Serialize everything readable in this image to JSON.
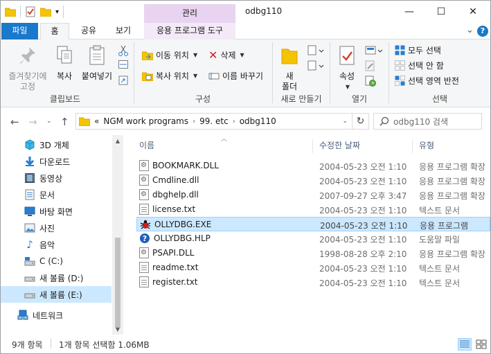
{
  "window": {
    "title": "odbg110",
    "context_tab_header": "관리"
  },
  "ribbon_tabs": {
    "file": "파일",
    "home": "홈",
    "share": "공유",
    "view": "보기",
    "app_tools": "응용 프로그램 도구"
  },
  "ribbon": {
    "clipboard": {
      "label": "클립보드",
      "pin": "즐겨찾기에\n고정",
      "pin_line1": "즐겨찾기에",
      "pin_line2": "고정",
      "copy": "복사",
      "paste": "붙여넣기"
    },
    "organize": {
      "label": "구성",
      "move_to": "이동 위치",
      "copy_to": "복사 위치",
      "delete": "삭제",
      "rename": "이름 바꾸기"
    },
    "new": {
      "label": "새로 만들기",
      "new_folder_line1": "새",
      "new_folder_line2": "폴더"
    },
    "open": {
      "label": "열기",
      "properties": "속성"
    },
    "select": {
      "label": "선택",
      "select_all": "모두 선택",
      "select_none": "선택 안 함",
      "invert": "선택 영역 반전"
    }
  },
  "address": {
    "overflow": "«",
    "crumbs": [
      "NGM work programs",
      "99. etc",
      "odbg110"
    ]
  },
  "search": {
    "placeholder": "odbg110 검색"
  },
  "nav_pane": {
    "items": [
      {
        "label": "3D 개체",
        "icon": "3d-objects-icon"
      },
      {
        "label": "다운로드",
        "icon": "download-icon"
      },
      {
        "label": "동영상",
        "icon": "video-icon"
      },
      {
        "label": "문서",
        "icon": "documents-icon"
      },
      {
        "label": "바탕 화면",
        "icon": "desktop-icon"
      },
      {
        "label": "사진",
        "icon": "pictures-icon"
      },
      {
        "label": "음악",
        "icon": "music-icon"
      },
      {
        "label": "C (C:)",
        "icon": "drive-c-icon"
      },
      {
        "label": "새 볼륨 (D:)",
        "icon": "drive-icon"
      },
      {
        "label": "새 볼륨 (E:)",
        "icon": "drive-icon"
      },
      {
        "label": "네트워크",
        "icon": "network-icon"
      }
    ]
  },
  "file_list": {
    "columns": {
      "name": "이름",
      "modified": "수정한 날짜",
      "type": "유형"
    },
    "rows": [
      {
        "name": "BOOKMARK.DLL",
        "modified": "2004-05-23 오전 1:10",
        "type": "응용 프로그램 확장",
        "icon": "dll-icon"
      },
      {
        "name": "Cmdline.dll",
        "modified": "2004-05-23 오전 1:10",
        "type": "응용 프로그램 확장",
        "icon": "dll-icon"
      },
      {
        "name": "dbghelp.dll",
        "modified": "2007-09-27 오후 3:47",
        "type": "응용 프로그램 확장",
        "icon": "dll-icon"
      },
      {
        "name": "license.txt",
        "modified": "2004-05-23 오전 1:10",
        "type": "텍스트 문서",
        "icon": "text-file-icon"
      },
      {
        "name": "OLLYDBG.EXE",
        "modified": "2004-05-23 오전 1:10",
        "type": "응용 프로그램",
        "icon": "ollydbg-bug-icon"
      },
      {
        "name": "OLLYDBG.HLP",
        "modified": "2004-05-23 오전 1:10",
        "type": "도움말 파일",
        "icon": "help-file-icon"
      },
      {
        "name": "PSAPI.DLL",
        "modified": "1998-08-28 오후 2:10",
        "type": "응용 프로그램 확장",
        "icon": "dll-icon"
      },
      {
        "name": "readme.txt",
        "modified": "2004-05-23 오전 1:10",
        "type": "텍스트 문서",
        "icon": "text-file-icon"
      },
      {
        "name": "register.txt",
        "modified": "2004-05-23 오전 1:10",
        "type": "텍스트 문서",
        "icon": "text-file-icon"
      }
    ],
    "selected_index": 4
  },
  "status": {
    "item_count": "9개 항목",
    "selection": "1개 항목 선택함 1.06MB"
  },
  "colors": {
    "accent": "#1979ca",
    "context_tab": "#e8d4f0",
    "selection": "#cce8ff",
    "selection_border": "#99d1ff"
  }
}
